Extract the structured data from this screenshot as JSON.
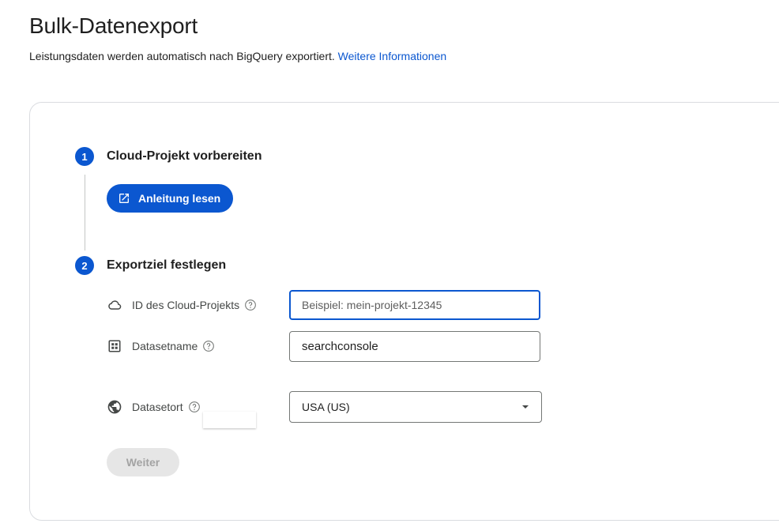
{
  "header": {
    "title": "Bulk-Datenexport",
    "description": "Leistungsdaten werden automatisch nach BigQuery exportiert.",
    "link_label": "Weitere Informationen"
  },
  "steps": [
    {
      "number": "1",
      "title": "Cloud-Projekt vorbereiten",
      "button_label": "Anleitung lesen",
      "button_icon": "open-in-new-icon"
    },
    {
      "number": "2",
      "title": "Exportziel festlegen"
    }
  ],
  "form": {
    "project_id": {
      "label": "ID des Cloud-Projekts",
      "icon": "cloud-icon",
      "value": "",
      "placeholder": "Beispiel: mein-projekt-12345"
    },
    "dataset_name": {
      "label": "Datasetname",
      "icon": "grid-icon",
      "value": "searchconsole"
    },
    "dataset_location": {
      "label": "Datasetort",
      "icon": "globe-icon",
      "selected": "USA (US)"
    },
    "submit_label": "Weiter"
  },
  "colors": {
    "accent": "#0b57d0",
    "border": "#dadce0",
    "disabled_bg": "#e6e6e6",
    "disabled_text": "#a3a3a3"
  }
}
